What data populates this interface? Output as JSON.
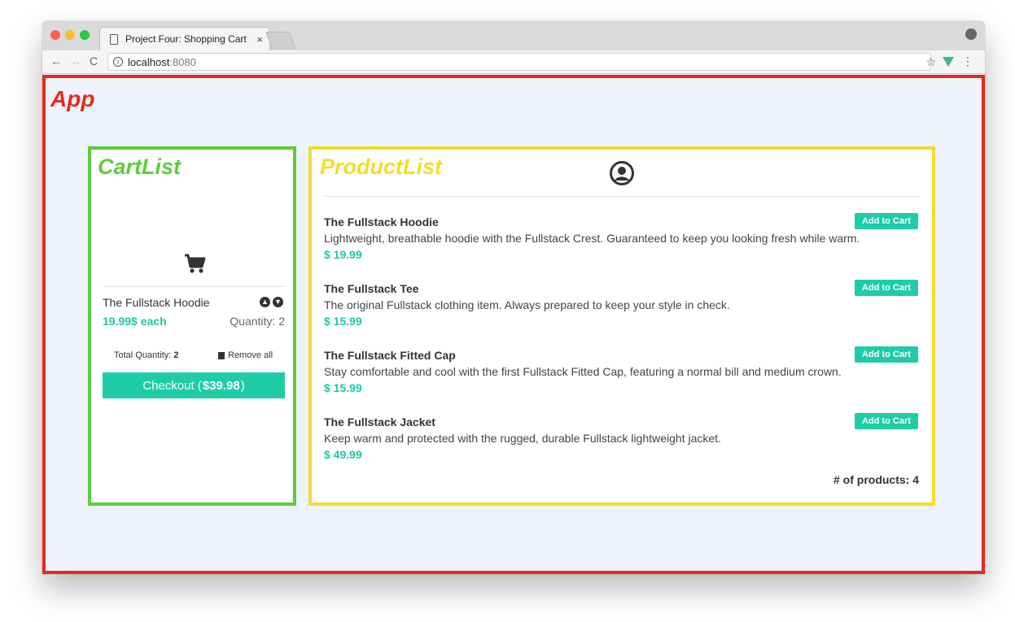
{
  "browser": {
    "tab_title": "Project Four: Shopping Cart",
    "tab_close": "×",
    "url_host": "localhost",
    "url_port": ":8080",
    "info_icon": "i",
    "nav_back": "←",
    "nav_forward": "→",
    "nav_reload": "C",
    "bookmark_star": "☆",
    "menu_dots": "⋮"
  },
  "app": {
    "label": "App"
  },
  "cart": {
    "label": "CartList",
    "item_name": "The Fullstack Hoodie",
    "item_price": "19.99$ each",
    "item_quantity": "Quantity: 2",
    "total_quantity_label": "Total Quantity: ",
    "total_quantity_value": "2",
    "remove_all": "Remove all",
    "checkout_prefix": "Checkout (",
    "checkout_amount": "$39.98",
    "checkout_suffix": ")",
    "up_arrow": "▲",
    "down_arrow": "▼"
  },
  "products": {
    "label": "ProductList",
    "add_label": "Add to Cart",
    "count_text": "# of products: 4",
    "items": [
      {
        "name": "The Fullstack Hoodie",
        "description": "Lightweight, breathable hoodie with the Fullstack Crest. Guaranteed to keep you looking fresh while warm.",
        "price": "$ 19.99"
      },
      {
        "name": "The Fullstack Tee",
        "description": "The original Fullstack clothing item. Always prepared to keep your style in check.",
        "price": "$ 15.99"
      },
      {
        "name": "The Fullstack Fitted Cap",
        "description": "Stay comfortable and cool with the first Fullstack Fitted Cap, featuring a normal bill and medium crown.",
        "price": "$ 15.99"
      },
      {
        "name": "The Fullstack Jacket",
        "description": "Keep warm and protected with the rugged, durable Fullstack lightweight jacket.",
        "price": "$ 49.99"
      }
    ]
  },
  "colors": {
    "app_frame": "#e52a1e",
    "cart_frame": "#5ccc3b",
    "product_frame": "#f3dc2d",
    "accent": "#1ecda8"
  },
  "icons": {
    "cart": "shopping-cart-icon",
    "user": "user-circle-icon",
    "trash": "trash-icon"
  }
}
